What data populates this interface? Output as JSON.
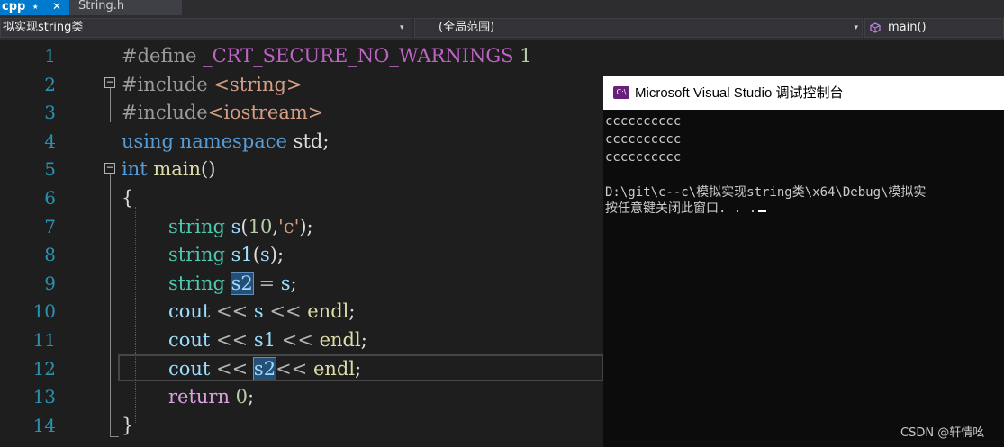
{
  "tabs": [
    {
      "label": "cpp",
      "active": true,
      "pin_glyph": "⭑",
      "close_glyph": "✕"
    },
    {
      "label": "String.h",
      "active": false
    }
  ],
  "nav": {
    "project": "拟实现string类",
    "scope": "(全局范围)",
    "function": "main()",
    "dropdown_glyph": "▾"
  },
  "editor": {
    "line_numbers": [
      "1",
      "2",
      "3",
      "4",
      "5",
      "6",
      "7",
      "8",
      "9",
      "10",
      "11",
      "12",
      "13",
      "14"
    ],
    "tokens": {
      "l1_define": "#define ",
      "l1_macro": "_CRT_SECURE_NO_WARNINGS",
      "l1_val": " 1",
      "l2_include": "#include ",
      "l2_header": "<string>",
      "l3_include": "#include",
      "l3_header": "<iostream>",
      "l4_using": "using",
      "l4_namespace": " namespace",
      "l4_rest": " std;",
      "l5_int": "int",
      "l5_main": " main",
      "l5_parens": "()",
      "l6_brace": "{",
      "l7_type": "string",
      "l7_var": " s",
      "l7_p1": "(",
      "l7_num": "10",
      "l7_comma": ",",
      "l7_char": "'c'",
      "l7_end": ");",
      "l8_type": "string",
      "l8_var": " s1",
      "l8_p1": "(",
      "l8_arg": "s",
      "l8_end": ");",
      "l9_type": "string",
      "l9_sp": " ",
      "l9_var": "s2",
      "l9_eq": " = ",
      "l9_arg": "s",
      "l9_end": ";",
      "l10_cout": "cout",
      "l10_op1": " << ",
      "l10_s": "s",
      "l10_op2": " << ",
      "l10_endl": "endl",
      "l10_end": ";",
      "l11_cout": "cout",
      "l11_op1": " << ",
      "l11_s": "s1",
      "l11_op2": " << ",
      "l11_endl": "endl",
      "l11_end": ";",
      "l12_cout": "cout",
      "l12_op1": " << ",
      "l12_s": "s2",
      "l12_op2": "<< ",
      "l12_endl": "endl",
      "l12_end": ";",
      "l13_return": "return",
      "l13_num": " 0",
      "l13_end": ";",
      "l14_brace": "}"
    },
    "collapse_glyph": "−"
  },
  "console": {
    "title": "Microsoft Visual Studio 调试控制台",
    "icon_text": "C:\\",
    "lines": [
      "cccccccccc",
      "cccccccccc",
      "cccccccccc",
      "",
      "D:\\git\\c--c\\模拟实现string类\\x64\\Debug\\模拟实",
      "按任意键关闭此窗口. . ."
    ]
  },
  "watermark": "CSDN @轩情吆"
}
